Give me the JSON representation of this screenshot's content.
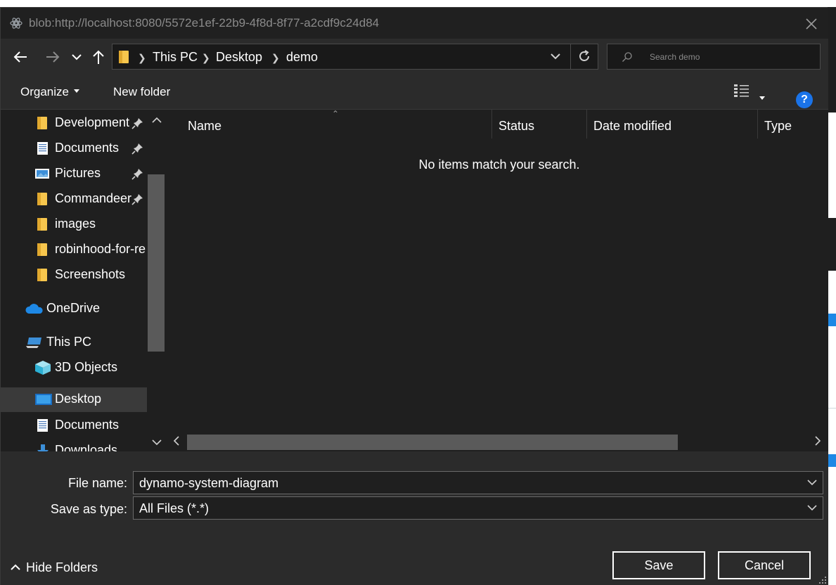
{
  "window": {
    "title": "blob:http://localhost:8080/5572e1ef-22b9-4f8d-8f77-a2cdf9c24d84"
  },
  "navigation": {
    "breadcrumbs": [
      "This PC",
      "Desktop",
      "demo"
    ],
    "search_placeholder": "Search demo"
  },
  "toolbar": {
    "organize_label": "Organize",
    "new_folder_label": "New folder",
    "help_label": "?"
  },
  "sidebar": {
    "quick_access": [
      {
        "label": "Development",
        "icon": "folder-icon",
        "pinned": true
      },
      {
        "label": "Documents",
        "icon": "documents-icon",
        "pinned": true
      },
      {
        "label": "Pictures",
        "icon": "pictures-icon",
        "pinned": true
      },
      {
        "label": "Commandeer",
        "icon": "folder-icon",
        "pinned": true
      },
      {
        "label": "images",
        "icon": "folder-icon",
        "pinned": false
      },
      {
        "label": "robinhood-for-re",
        "icon": "folder-icon",
        "pinned": false
      },
      {
        "label": "Screenshots",
        "icon": "folder-icon",
        "pinned": false
      }
    ],
    "onedrive_label": "OneDrive",
    "this_pc_label": "This PC",
    "this_pc_items": [
      {
        "label": "3D Objects",
        "icon": "3d-objects-icon"
      },
      {
        "label": "Desktop",
        "icon": "desktop-icon",
        "selected": true
      },
      {
        "label": "Documents",
        "icon": "documents-icon"
      },
      {
        "label": "Downloads",
        "icon": "downloads-icon"
      }
    ]
  },
  "file_list": {
    "columns": [
      "Name",
      "Status",
      "Date modified",
      "Type"
    ],
    "empty_message": "No items match your search."
  },
  "form": {
    "file_name_label": "File name:",
    "file_name_value": "dynamo-system-diagram",
    "save_type_label": "Save as type:",
    "save_type_value": "All Files (*.*)"
  },
  "footer": {
    "hide_folders_label": "Hide Folders",
    "save_label": "Save",
    "cancel_label": "Cancel"
  },
  "colors": {
    "background": "#2b2b2b",
    "pane_background": "#1f1f1f",
    "accent_blue": "#1a73e8",
    "folder_yellow": "#f7c64d"
  }
}
